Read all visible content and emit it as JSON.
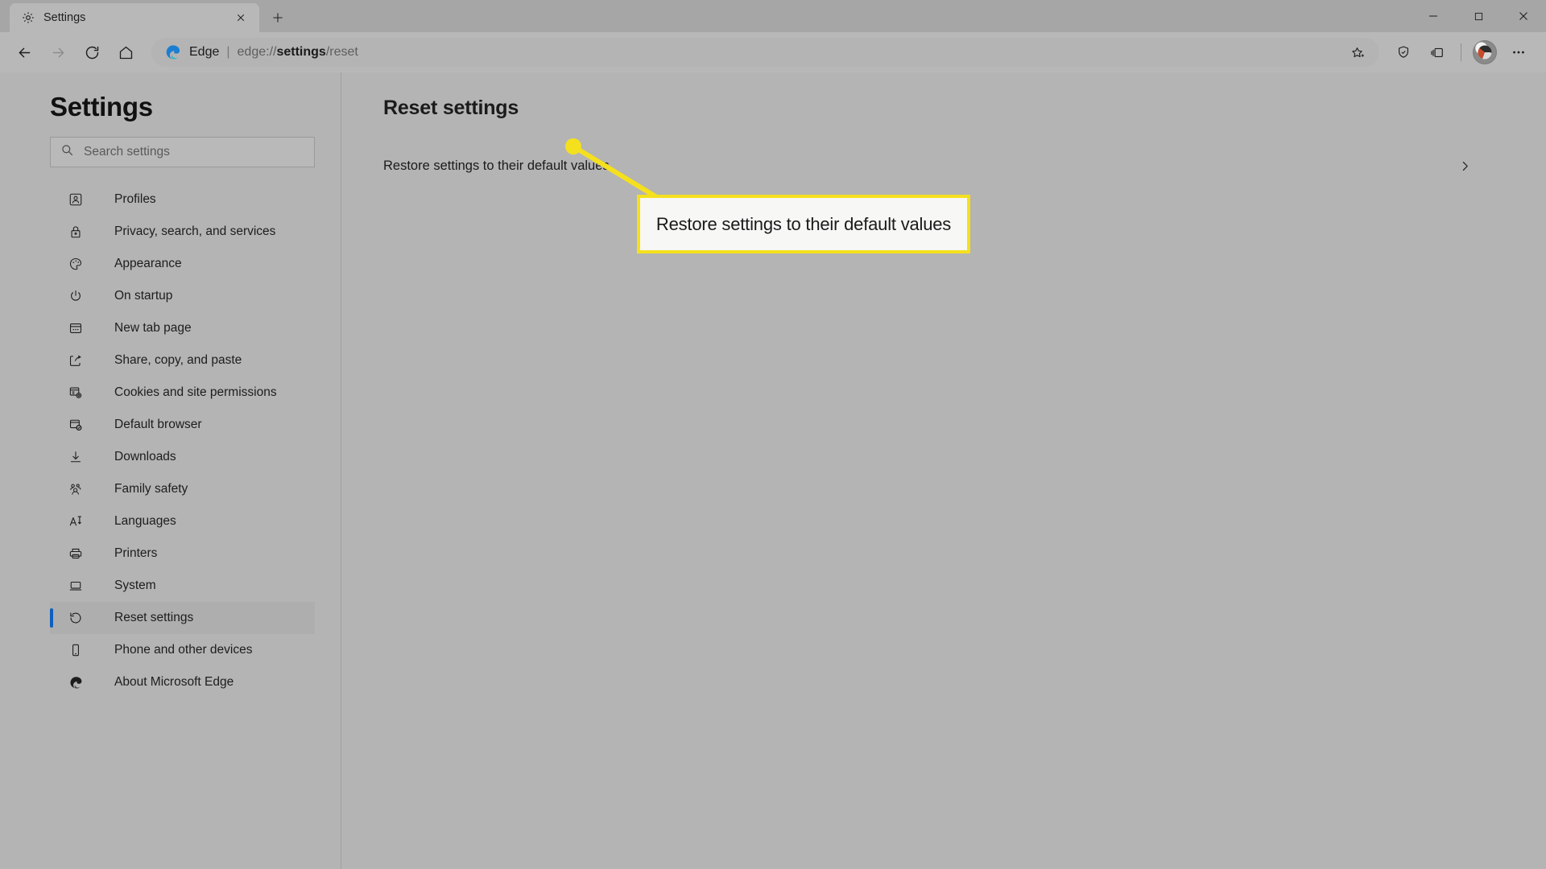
{
  "window": {
    "tab": {
      "title": "Settings",
      "icon": "gear-icon",
      "close_label": "✕"
    },
    "new_tab_label": "+",
    "controls": {
      "minimize": "─",
      "maximize": "□",
      "close": "✕"
    }
  },
  "toolbar": {
    "back": "back-arrow-icon",
    "forward": "forward-arrow-icon",
    "refresh": "refresh-icon",
    "home": "home-icon",
    "brand": "Edge",
    "separator": "|",
    "url_prefix": "edge://",
    "url_bold": "settings",
    "url_suffix": "/reset",
    "url_full": "edge://settings/reset",
    "favorite": "star-add-icon",
    "collections": "collections-icon",
    "tabs_bar": "browser-essentials-icon",
    "profile": "avatar",
    "more": "···"
  },
  "sidebar": {
    "title": "Settings",
    "search": {
      "placeholder": "Search settings",
      "icon": "search-icon"
    },
    "items": [
      {
        "label": "Profiles",
        "icon": "profile-icon",
        "selected": false
      },
      {
        "label": "Privacy, search, and services",
        "icon": "lock-icon",
        "selected": false
      },
      {
        "label": "Appearance",
        "icon": "palette-icon",
        "selected": false
      },
      {
        "label": "On startup",
        "icon": "power-icon",
        "selected": false
      },
      {
        "label": "New tab page",
        "icon": "new-tab-page-icon",
        "selected": false
      },
      {
        "label": "Share, copy, and paste",
        "icon": "share-icon",
        "selected": false
      },
      {
        "label": "Cookies and site permissions",
        "icon": "cookies-icon",
        "selected": false
      },
      {
        "label": "Default browser",
        "icon": "default-browser-icon",
        "selected": false
      },
      {
        "label": "Downloads",
        "icon": "download-icon",
        "selected": false
      },
      {
        "label": "Family safety",
        "icon": "family-icon",
        "selected": false
      },
      {
        "label": "Languages",
        "icon": "languages-icon",
        "selected": false
      },
      {
        "label": "Printers",
        "icon": "printer-icon",
        "selected": false
      },
      {
        "label": "System",
        "icon": "laptop-icon",
        "selected": false
      },
      {
        "label": "Reset settings",
        "icon": "reset-icon",
        "selected": true
      },
      {
        "label": "Phone and other devices",
        "icon": "phone-icon",
        "selected": false
      },
      {
        "label": "About Microsoft Edge",
        "icon": "edge-logo-icon",
        "selected": false
      }
    ]
  },
  "main": {
    "page_title": "Reset settings",
    "rows": [
      {
        "label": "Restore settings to their default values",
        "chevron": "chevron-right-icon"
      }
    ]
  },
  "annotation": {
    "callout_text": "Restore settings to their default values",
    "border_color": "#f5e01e",
    "fill_color": "#f7f7f5",
    "line_color": "#f5e01e",
    "dot_color": "#f5e01e"
  },
  "colors": {
    "accent": "#0f5fbd",
    "page_background": "#b4b4b4",
    "titlebar": "#a6a6a6",
    "toolbar": "#b8b8b8",
    "selected_row": "#aeaeae"
  }
}
